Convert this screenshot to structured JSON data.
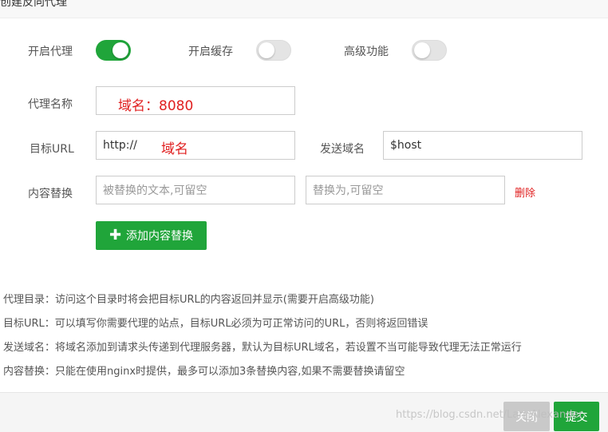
{
  "dialog": {
    "title": "创建反向代理"
  },
  "switches": {
    "proxy": {
      "label": "开启代理",
      "state": "on"
    },
    "cache": {
      "label": "开启缓存",
      "state": "off"
    },
    "advanced": {
      "label": "高级功能",
      "state": "off"
    }
  },
  "form": {
    "proxy_name": {
      "label": "代理名称",
      "value": "",
      "overlay": "域名：8080"
    },
    "target_url": {
      "label": "目标URL",
      "value": "http://",
      "overlay": "域名"
    },
    "send_domain": {
      "label": "发送域名",
      "value": "$host"
    },
    "content_replace": {
      "label": "内容替换",
      "source_placeholder": "被替换的文本,可留空",
      "target_placeholder": "替换为,可留空",
      "delete_label": "删除"
    },
    "add_button_label": "添加内容替换"
  },
  "help": [
    "代理目录：访问这个目录时将会把目标URL的内容返回并显示(需要开启高级功能)",
    "目标URL：可以填写你需要代理的站点，目标URL必须为可正常访问的URL，否则将返回错误",
    "发送域名：将域名添加到请求头传递到代理服务器，默认为目标URL域名，若设置不当可能导致代理无法正常运行",
    "内容替换：只能在使用nginx时提供，最多可以添加3条替换内容,如果不需要替换请留空"
  ],
  "footer": {
    "close_label": "关闭",
    "submit_label": "提交"
  },
  "watermark": "https://blog.csdn.net/Lan_Alexander",
  "colors": {
    "accent": "#20a53a",
    "danger": "#e02020",
    "disabled": "#c9c9c9"
  }
}
